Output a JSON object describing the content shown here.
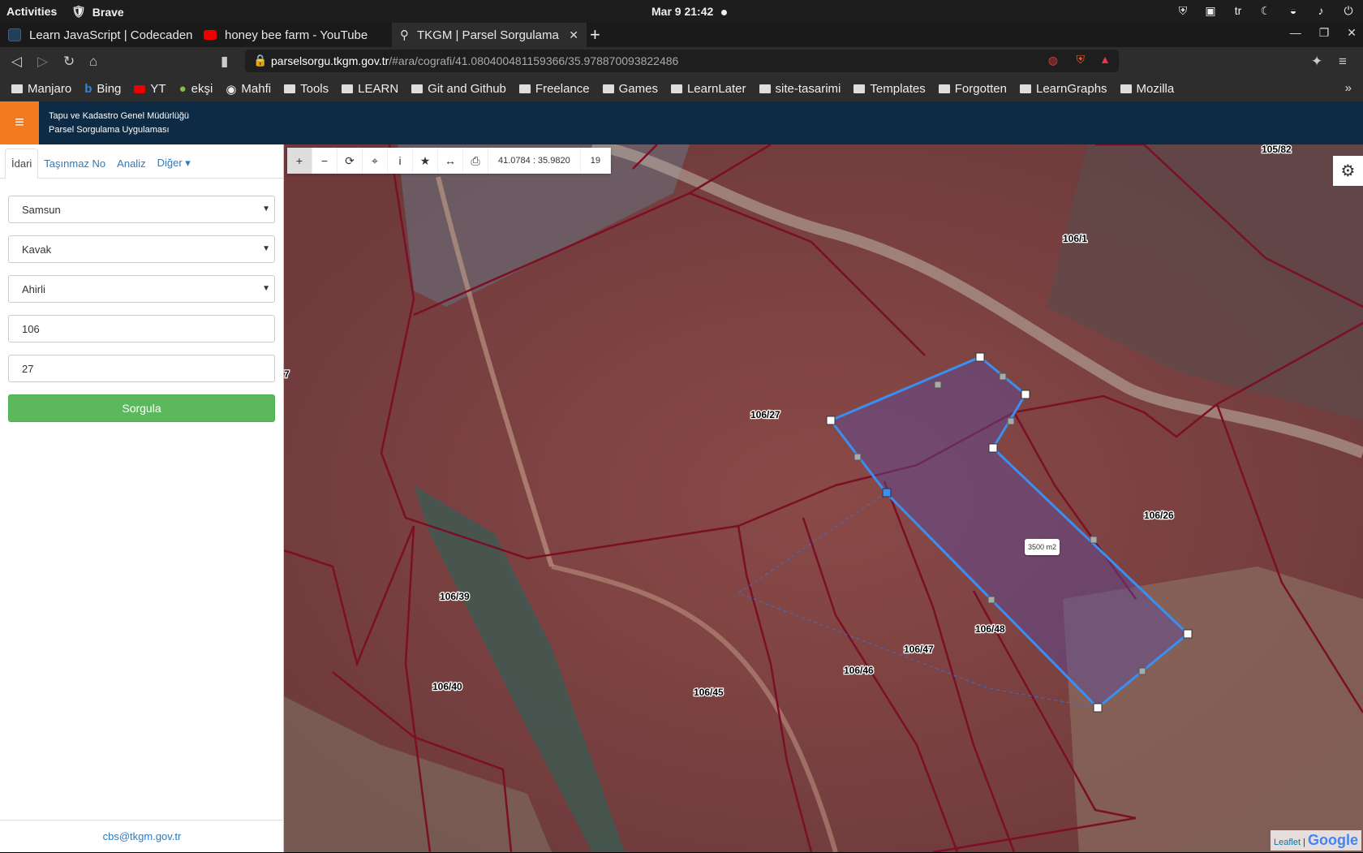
{
  "system": {
    "activities": "Activities",
    "app": "Brave",
    "clock": "Mar 9  21:42",
    "lang": "tr"
  },
  "tabs": [
    {
      "title": "Learn JavaScript | Codecaden",
      "icon": "codecademy-icon"
    },
    {
      "title": "honey bee farm - YouTube",
      "icon": "youtube-icon"
    },
    {
      "title": "TKGM | Parsel Sorgulama",
      "icon": "location-pin-icon"
    }
  ],
  "url": {
    "host": "parselsorgu.tkgm.gov.tr",
    "path": "/#ara/cografi/41.080400481159366/35.978870093822486"
  },
  "bookmarks": [
    "Manjaro",
    "Bing",
    "YT",
    "ekşi",
    "Mahfi",
    "Tools",
    "LEARN",
    "Git and Github",
    "Freelance",
    "Games",
    "LearnLater",
    "site-tasarimi",
    "Templates",
    "Forgotten",
    "LearnGraphs",
    "Mozilla"
  ],
  "header": {
    "line1": "Tapu ve Kadastro Genel Müdürlüğü",
    "line2": "Parsel Sorgulama Uygulaması"
  },
  "sidebar": {
    "tabs": [
      "İdari",
      "Taşınmaz No",
      "Analiz",
      "Diğer ▾"
    ],
    "il": "Samsun",
    "ilce": "Kavak",
    "mahalle": "Ahirli",
    "ada": "106",
    "parsel": "27",
    "button": "Sorgula",
    "footer": "cbs@tkgm.gov.tr"
  },
  "map": {
    "coords": "41.0784 : 35.9820",
    "zoom": "19",
    "area_tooltip": "3500 m2",
    "parcels": [
      "105/82",
      "106/1",
      "106/27",
      "106/26",
      "106/39",
      "106/48",
      "106/47",
      "106/46",
      "106/45",
      "106/40",
      "7"
    ],
    "attribution_leaflet": "Leaflet",
    "attribution_google": "Google"
  }
}
